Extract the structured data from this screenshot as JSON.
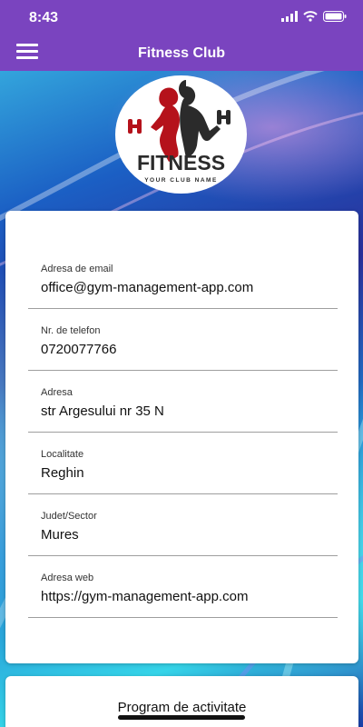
{
  "status_bar": {
    "time": "8:43"
  },
  "app_bar": {
    "title": "Fitness Club"
  },
  "logo": {
    "brand": "FITNESS",
    "tagline": "YOUR CLUB NAME"
  },
  "contact_fields": [
    {
      "label": "Adresa de email",
      "value": "office@gym-management-app.com"
    },
    {
      "label": "Nr. de telefon",
      "value": "0720077766"
    },
    {
      "label": "Adresa",
      "value": "str Argesului nr 35 N"
    },
    {
      "label": "Localitate",
      "value": "Reghin"
    },
    {
      "label": "Judet/Sector",
      "value": "Mures"
    },
    {
      "label": "Adresa web",
      "value": "https://gym-management-app.com"
    }
  ],
  "schedule": {
    "button_label": "Program de activitate"
  },
  "colors": {
    "accent": "#7a44bf",
    "logo_red": "#b5121b",
    "logo_dark": "#2b2b2b"
  }
}
